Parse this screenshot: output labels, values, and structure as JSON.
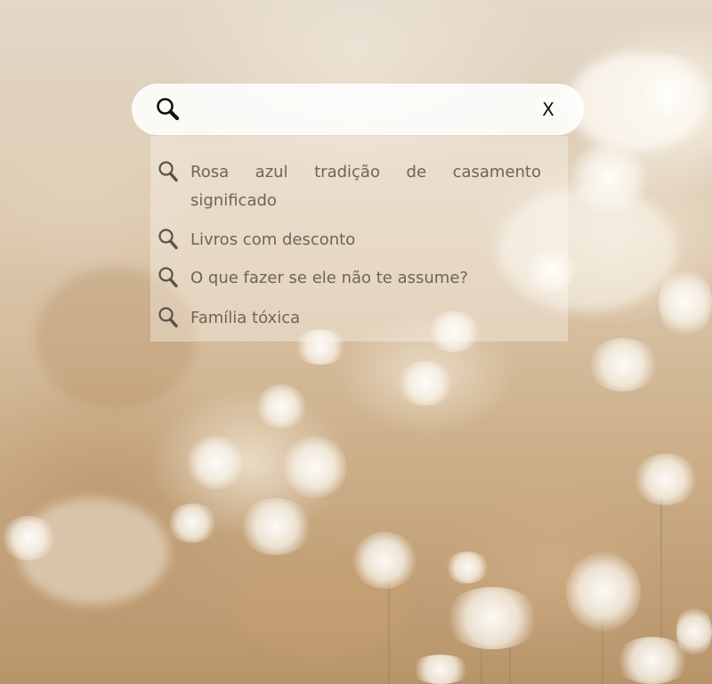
{
  "search": {
    "value": "",
    "placeholder": "",
    "clear_label": "X"
  },
  "suggestions": [
    {
      "text": "Rosa azul tradição de casamento significado"
    },
    {
      "text": "Livros com desconto"
    },
    {
      "text": "O que fazer se ele não te assume?"
    },
    {
      "text": "Família tóxica"
    }
  ],
  "icons": {
    "search": "search-icon",
    "clear": "close-icon",
    "suggestion": "search-icon"
  },
  "colors": {
    "suggestion_text": "#6e6557",
    "icon": "#111111",
    "suggestion_icon": "#5a5248"
  }
}
